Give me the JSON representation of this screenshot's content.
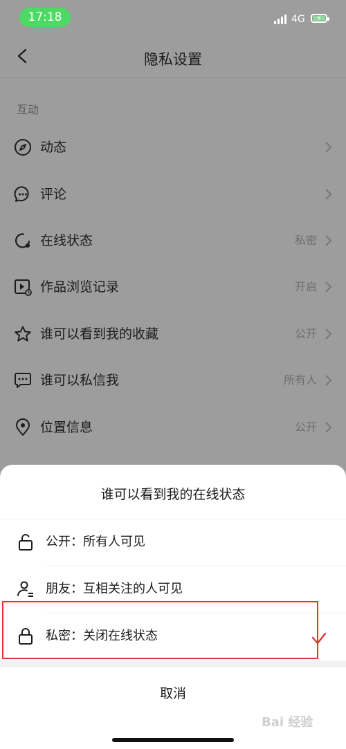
{
  "status_bar": {
    "time": "17:18",
    "network": "4G"
  },
  "nav": {
    "title": "隐私设置"
  },
  "section": {
    "header": "互动"
  },
  "rows": [
    {
      "label": "动态",
      "value": ""
    },
    {
      "label": "评论",
      "value": ""
    },
    {
      "label": "在线状态",
      "value": "私密"
    },
    {
      "label": "作品浏览记录",
      "value": "开启"
    },
    {
      "label": "谁可以看到我的收藏",
      "value": "公开"
    },
    {
      "label": "谁可以私信我",
      "value": "所有人"
    },
    {
      "label": "位置信息",
      "value": "公开"
    }
  ],
  "sheet": {
    "title": "谁可以看到我的在线状态",
    "options": [
      {
        "text": "公开：所有人可见",
        "icon": "unlock-icon"
      },
      {
        "text": "朋友：互相关注的人可见",
        "icon": "friends-icon"
      },
      {
        "text": "私密：关闭在线状态",
        "icon": "lock-icon",
        "selected": true
      }
    ],
    "cancel": "取消"
  },
  "watermark": "Bai 经验",
  "colors": {
    "status_green": "#4cd964",
    "highlight_red": "#e0342f",
    "check_red": "#e0342f"
  }
}
